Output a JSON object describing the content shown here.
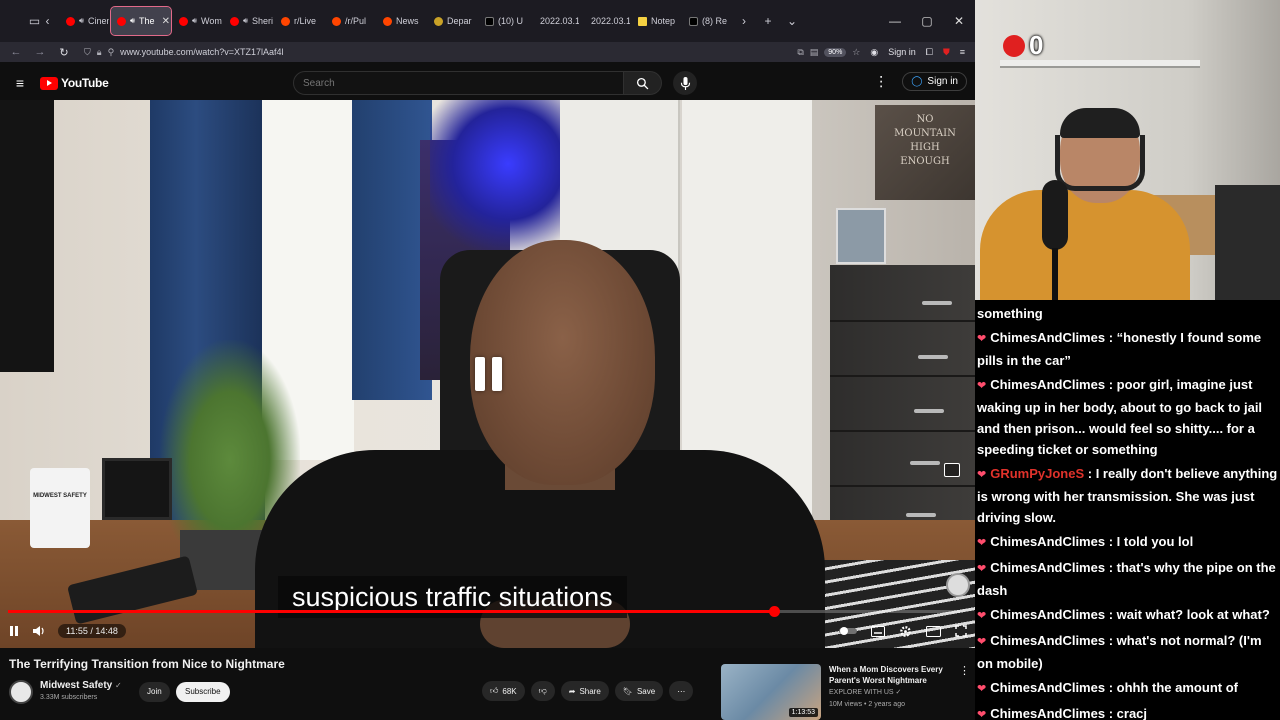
{
  "browser": {
    "tabs": [
      {
        "label": "Cinem",
        "favicon": "youtube",
        "active": false
      },
      {
        "label": "The",
        "favicon": "youtube",
        "active": true
      },
      {
        "label": "Wom",
        "favicon": "youtube",
        "active": false
      },
      {
        "label": "Sherif",
        "favicon": "youtube",
        "active": false
      },
      {
        "label": "r/Live",
        "favicon": "reddit",
        "active": false
      },
      {
        "label": "/r/Pul",
        "favicon": "reddit",
        "active": false
      },
      {
        "label": "News",
        "favicon": "reddit",
        "active": false
      },
      {
        "label": "Depar",
        "favicon": "gold",
        "active": false
      },
      {
        "label": "(10) U",
        "favicon": "x",
        "active": false
      },
      {
        "label": "2022.03.1",
        "favicon": "none",
        "active": false
      },
      {
        "label": "2022.03.1",
        "favicon": "none",
        "active": false
      },
      {
        "label": "Notep",
        "favicon": "note",
        "active": false
      },
      {
        "label": "(8) Re",
        "favicon": "x",
        "active": false
      }
    ],
    "url": "www.youtube.com/watch?v=XTZ17lAaf4l",
    "zoom": "90%",
    "signin_label": "Sign in"
  },
  "youtube": {
    "logo_text": "YouTube",
    "search_placeholder": "Search",
    "signin_label": "Sign in"
  },
  "video": {
    "caption": "suspicious traffic situations",
    "current_time": "11:55",
    "duration": "14:48",
    "time_display": "11:55 / 14:48",
    "progress_fraction": 0.805,
    "sign_text": [
      "NO",
      "MOUNTAIN",
      "HIGH",
      "ENOUGH"
    ],
    "mug_text": "MIDWEST SAFETY",
    "title": "The Terrifying Transition from Nice to Nightmare",
    "channel": "Midwest Safety",
    "subscribers": "3.33M subscribers",
    "join_label": "Join",
    "subscribe_label": "Subscribe",
    "likes": "68K",
    "share_label": "Share",
    "save_label": "Save"
  },
  "recommendation": {
    "title": "When a Mom Discovers Every Parent's Worst Nightmare",
    "channel": "EXPLORE WITH US",
    "meta": "10M views • 2 years ago",
    "duration": "1:13:53"
  },
  "webcam": {
    "counter": "0"
  },
  "chat": {
    "messages": [
      {
        "user": "",
        "text": "something",
        "color": "#ffffff"
      },
      {
        "user": "ChimesAndClimes",
        "text": "“honestly I found some pills in the car”",
        "color": "#ffffff"
      },
      {
        "user": "ChimesAndClimes",
        "text": "poor girl, imagine just waking up in her body, about to go back to jail and then prison... would feel so shitty.... for a speeding ticket or something",
        "color": "#ffffff"
      },
      {
        "user": "GRumPyJoneS",
        "text": "I really don't believe anything is wrong with her transmission. She was just driving slow.",
        "color": "#e0322b"
      },
      {
        "user": "ChimesAndClimes",
        "text": "I told you lol",
        "color": "#ffffff"
      },
      {
        "user": "ChimesAndClimes",
        "text": "that's why the pipe on the dash",
        "color": "#ffffff"
      },
      {
        "user": "ChimesAndClimes",
        "text": "wait what? look at what?",
        "color": "#ffffff"
      },
      {
        "user": "ChimesAndClimes",
        "text": "what's not normal? (I'm on mobile)",
        "color": "#ffffff"
      },
      {
        "user": "ChimesAndClimes",
        "text": "ohhh the amount of",
        "color": "#ffffff"
      },
      {
        "user": "ChimesAndClimes",
        "text": "cracj",
        "color": "#ffffff"
      }
    ]
  }
}
